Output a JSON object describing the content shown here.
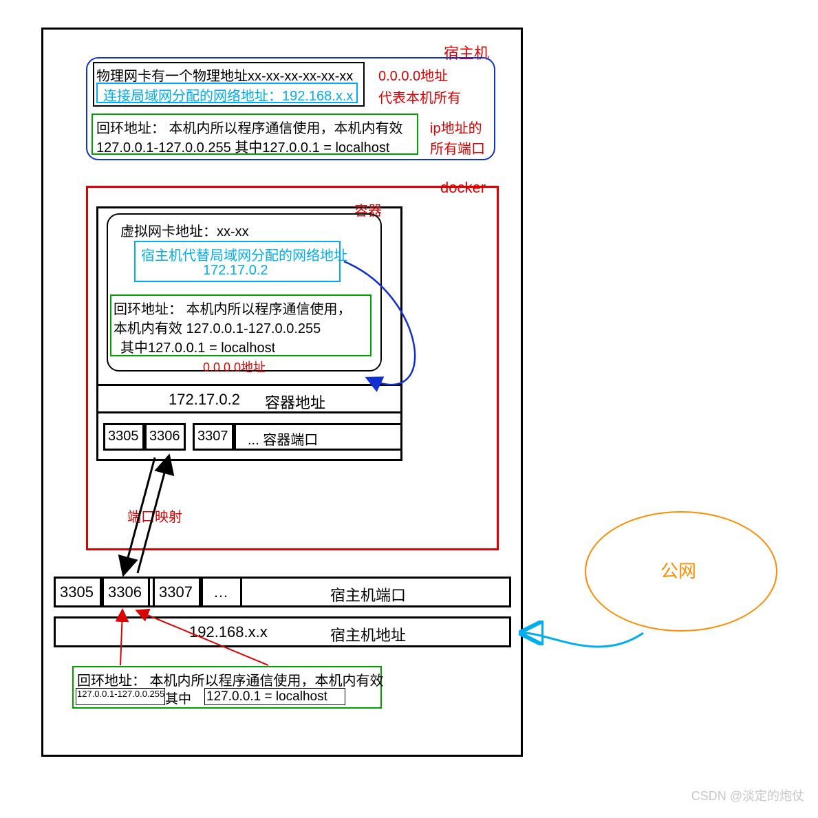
{
  "host_label": "宿主机",
  "nic_box": {
    "physical": "物理网卡有一个物理地址xx-xx-xx-xx-xx-xx",
    "lan_text": "连接局域网分配的网络地址：192.168.x.x",
    "loop_text1": "回环地址： 本机内所以程序通信使用，本机内有效",
    "loop_text2": "127.0.0.1-127.0.0.255   其中127.0.0.1 = localhost",
    "right1": "0.0.0.0地址",
    "right2": "代表本机所有",
    "right3": "ip地址的",
    "right4": "所有端口"
  },
  "docker_label": "docker",
  "container_label": "容器",
  "container": {
    "vnic": "虚拟网卡地址：xx-xx",
    "host_alloc1": "宿主机代替局域网分配的网络地址",
    "host_alloc2": "172.17.0.2",
    "loop1": "回环地址： 本机内所以程序通信使用，",
    "loop2": "本机内有效   127.0.0.1-127.0.0.255",
    "loop3": "  其中127.0.0.1 = localhost",
    "zero_addr": "0.0.0.0地址"
  },
  "container_addr_row": {
    "ip": "172.17.0.2",
    "label": "容器地址"
  },
  "container_ports": {
    "p1": "3305",
    "p2": "3306",
    "p3": "3307",
    "rest": "... 容器端口"
  },
  "port_mapping_label": "端口映射",
  "host_ports": {
    "p1": "3305",
    "p2": "3306",
    "p3": "3307",
    "rest": "…",
    "label": "宿主机端口"
  },
  "host_addr_row": {
    "ip": "192.168.x.x",
    "label": "宿主机地址"
  },
  "host_loop_box": {
    "line1": "回环地址： 本机内所以程序通信使用，本机内有效",
    "line2a": "127.0.0.1-127.0.0.255",
    "line2b": "  其中",
    "line2c": "127.0.0.1 = localhost"
  },
  "public_net": "公网",
  "watermark": "CSDN @淡定的炮仗"
}
